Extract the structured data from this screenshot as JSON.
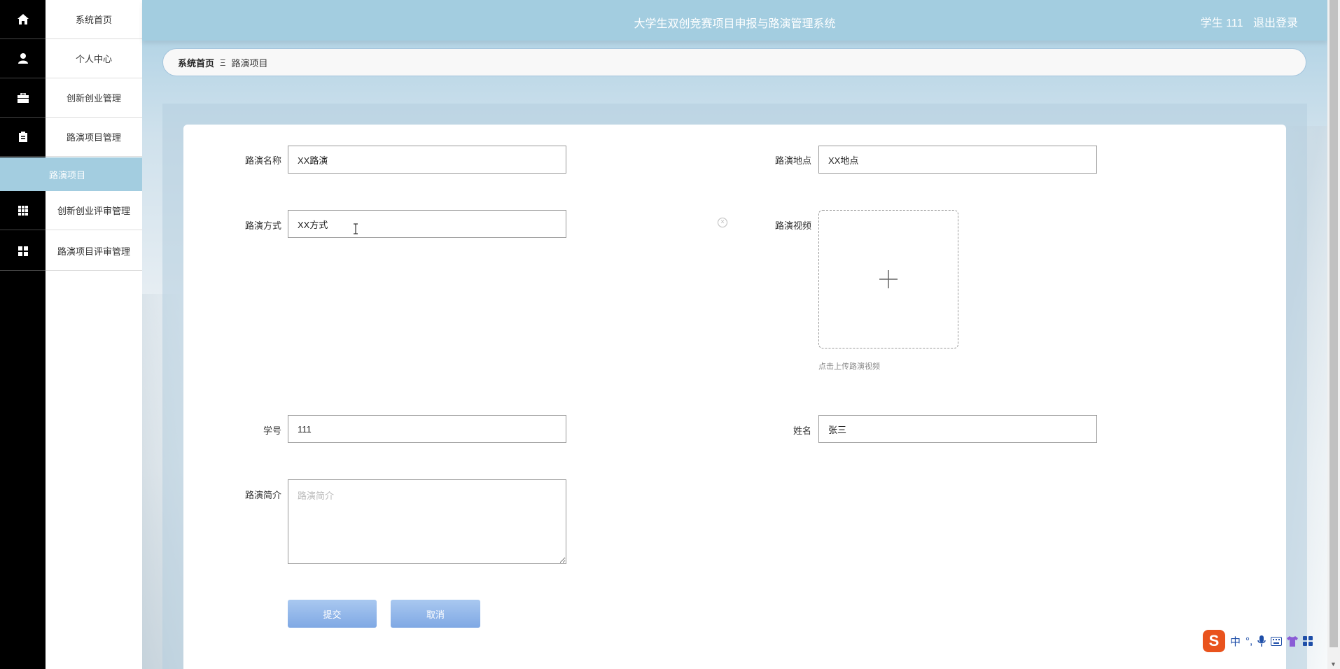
{
  "header": {
    "title": "大学生双创竞赛项目申报与路演管理系统",
    "user": "学生 111",
    "logout": "退出登录"
  },
  "sidebar": {
    "items": [
      {
        "label": "系统首页",
        "icon": "home-icon"
      },
      {
        "label": "个人中心",
        "icon": "user-icon"
      },
      {
        "label": "创新创业管理",
        "icon": "briefcase-icon"
      },
      {
        "label": "路演项目管理",
        "icon": "clipboard-icon"
      },
      {
        "label": "创新创业评审管理",
        "icon": "grid-icon"
      },
      {
        "label": "路演项目评审管理",
        "icon": "apps-icon"
      }
    ],
    "active_sub": "路演项目"
  },
  "breadcrumb": {
    "home": "系统首页",
    "separator": "Ξ",
    "current": "路演项目"
  },
  "form": {
    "name_label": "路演名称",
    "name_value": "XX路演",
    "location_label": "路演地点",
    "location_value": "XX地点",
    "method_label": "路演方式",
    "method_value": "XX方式",
    "video_label": "路演视频",
    "video_hint": "点击上传路演视频",
    "student_id_label": "学号",
    "student_id_value": "111",
    "student_name_label": "姓名",
    "student_name_value": "张三",
    "intro_label": "路演简介",
    "intro_placeholder": "路演简介",
    "submit": "提交",
    "cancel": "取消"
  },
  "ime": {
    "lang": "中",
    "punct": "°,"
  },
  "colors": {
    "accent": "#a3cde0",
    "button": "#8fb4ea",
    "sidebar_icons_bg": "#000000"
  }
}
